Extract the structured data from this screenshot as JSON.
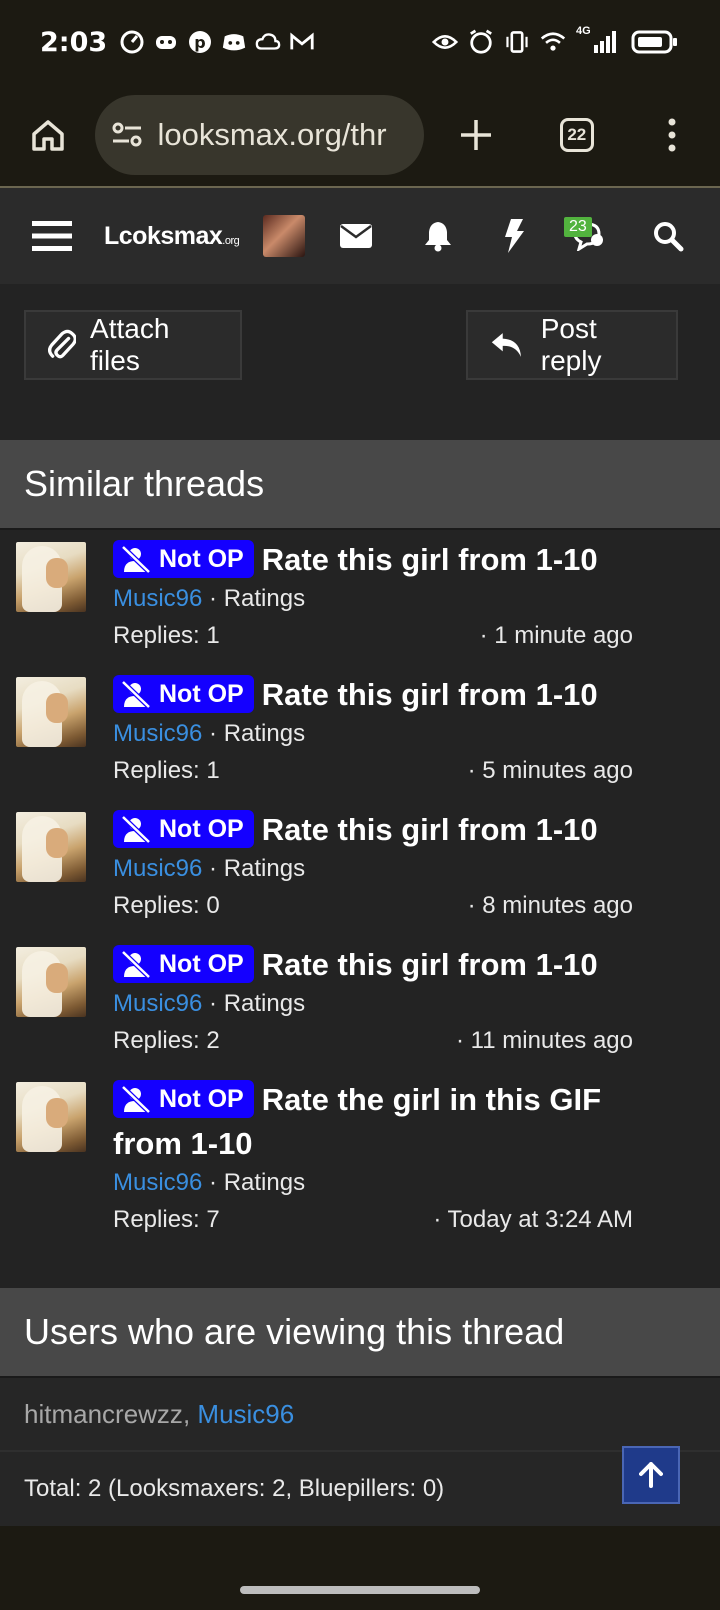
{
  "status_bar": {
    "time": "2:03",
    "network": "4G"
  },
  "browser": {
    "url": "looksmax.org/thr",
    "tab_count": "22"
  },
  "site_nav": {
    "logo": "Lcoksmax",
    "logo_suffix": ".org",
    "chat_badge": "23"
  },
  "actions": {
    "attach_label": "Attach files",
    "reply_label": "Post reply"
  },
  "similar": {
    "heading": "Similar threads",
    "threads": [
      {
        "badge": "Not OP",
        "title": "Rate this girl from 1-10",
        "user": "Music96",
        "forum": "Ratings",
        "replies": "Replies: 1",
        "time": "1 minute ago"
      },
      {
        "badge": "Not OP",
        "title": "Rate this girl from 1-10",
        "user": "Music96",
        "forum": "Ratings",
        "replies": "Replies: 1",
        "time": "5 minutes ago"
      },
      {
        "badge": "Not OP",
        "title": "Rate this girl from 1-10",
        "user": "Music96",
        "forum": "Ratings",
        "replies": "Replies: 0",
        "time": "8 minutes ago"
      },
      {
        "badge": "Not OP",
        "title": "Rate this girl from 1-10",
        "user": "Music96",
        "forum": "Ratings",
        "replies": "Replies: 2",
        "time": "11 minutes ago"
      },
      {
        "badge": "Not OP",
        "title": "Rate the girl in this GIF from 1-10",
        "user": "Music96",
        "forum": "Ratings",
        "replies": "Replies: 7",
        "time": "Today at 3:24 AM"
      }
    ]
  },
  "viewing": {
    "heading": "Users who are viewing this thread",
    "user1": "hitmancrewzz",
    "separator": ",",
    "user2": "Music96",
    "total": "Total: 2 (Looksmaxers: 2, Bluepillers: 0)"
  },
  "colors": {
    "badge_blue": "#1400ff",
    "link_blue": "#3a8fe0",
    "chat_badge_green": "#52b33e"
  }
}
